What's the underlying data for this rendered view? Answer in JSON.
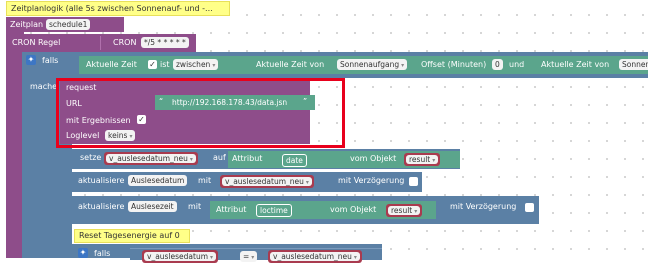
{
  "comment": "Zeitplanlogik (alle 5s zwischen Sonnenauf- und -...",
  "zeitplan": {
    "label": "Zeitplan",
    "value": "schedule1"
  },
  "cron": {
    "label": "CRON Regel",
    "inner_label": "CRON",
    "value": "*/5 * * * * *"
  },
  "falls_label": "falls",
  "condition": {
    "aktuelle_zeit": "Aktuelle Zeit",
    "ist": "ist",
    "operator": "zwischen",
    "aktuelle_zeit_von": "Aktuelle Zeit von",
    "sunrise": "Sonnenaufgang",
    "offset_label": "Offset (Minuten)",
    "offset_value": "0",
    "und": "und",
    "aktuelle_zeit_von2": "Aktuelle Zeit von",
    "sunset": "Sonnenunter"
  },
  "mache_label": "mache",
  "request": {
    "title": "request",
    "url_label": "URL",
    "url_open_quote": "“",
    "url_value": "http://192.168.178.43/data.jsn",
    "url_close_quote": "”",
    "mit_ergebnissen": "mit Ergebnissen",
    "loglevel_label": "Loglevel",
    "loglevel_value": "keins"
  },
  "setze": {
    "setze": "setze",
    "var": "v_auslesedatum_neu",
    "auf": "auf",
    "attribut": "Attribut",
    "attr_value": "date",
    "vom_objekt": "vom Objekt",
    "obj": "result"
  },
  "aktualisiere1": {
    "label": "aktualisiere",
    "target": "Auslesedatum",
    "mit": "mit",
    "var": "v_auslesedatum_neu",
    "mit_verzoegerung": "mit Verzögerung"
  },
  "aktualisiere2": {
    "label": "aktualisiere",
    "target": "Auslesezeit",
    "mit": "mit",
    "attribut": "Attribut",
    "attr_value": "loctime",
    "vom_objekt": "vom Objekt",
    "obj": "result",
    "mit_verzoegerung": "mit Verzögerung"
  },
  "reset_comment": "Reset Tagesenergie auf 0",
  "falls2": {
    "label": "falls",
    "var1": "v_auslesedatum",
    "op": "=",
    "var2": "v_auslesedatum_neu"
  },
  "colors": {
    "schedule_purple": "#8e4d8a",
    "logic_blue": "#5b80a5",
    "object_teal": "#5ba58c",
    "variable_red": "#a93b4f",
    "highlight_red": "#e8001c",
    "comment_yellow": "#ffff66"
  },
  "icons": [
    "gear-icon",
    "checkbox-checked-icon",
    "dropdown-arrow-icon"
  ]
}
